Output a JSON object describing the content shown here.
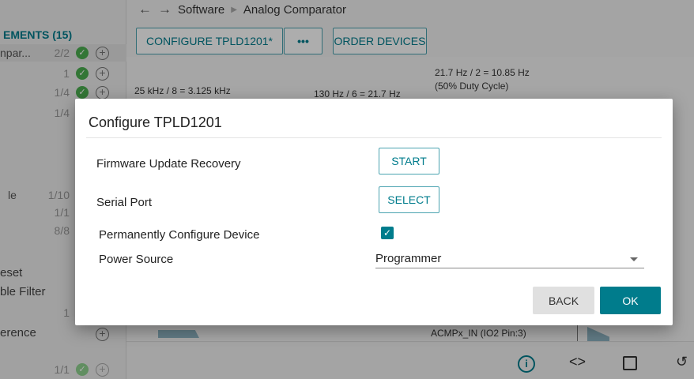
{
  "breadcrumb": {
    "back_icon": "arrow-left",
    "forward_icon": "arrow-right",
    "parts": [
      "Software",
      "Analog Comparator"
    ]
  },
  "toolbar": {
    "configure_label": "CONFIGURE TPLD1201*",
    "more_label": "•••",
    "order_label": "ORDER DEVICES"
  },
  "sidebar": {
    "header": "EMENTS (15)",
    "rows": [
      {
        "name": "npar...",
        "count": "2/2"
      },
      {
        "name": "",
        "count": "1"
      },
      {
        "name": "",
        "count": "1/4"
      },
      {
        "name": "",
        "count": "1/4"
      },
      {
        "name": "le",
        "count": "1/10"
      },
      {
        "name": "",
        "count": "1/1"
      },
      {
        "name": "",
        "count": "8/8"
      },
      {
        "name": "",
        "count": "1"
      },
      {
        "name": "",
        "count": "1/1"
      }
    ],
    "text_reset": "eset",
    "text_filter": "ble Filter",
    "text_reference": "erence"
  },
  "canvas": {
    "text_25khz": "25 kHz / 8 = 3.125 kHz",
    "text_130hz": "130 Hz / 6 = 21.7 Hz",
    "text_21hz": "21.7 Hz / 2 = 10.85 Hz",
    "text_duty": "(50% Duty Cycle)",
    "text_acmp": "ACMPx_IN (IO2 Pin:3)"
  },
  "bottom_icons": [
    "info-icon",
    "code-icon",
    "chip-icon",
    "history-icon"
  ],
  "dialog": {
    "title": "Configure TPLD1201",
    "firmware_label": "Firmware Update Recovery",
    "start_label": "START",
    "serial_label": "Serial Port",
    "select_label": "SELECT",
    "permanent_label": "Permanently Configure Device",
    "permanent_checked": true,
    "power_label": "Power Source",
    "power_value": "Programmer",
    "back_label": "BACK",
    "ok_label": "OK"
  },
  "colors": {
    "accent": "#007c8c",
    "check_green": "#4caf50"
  }
}
